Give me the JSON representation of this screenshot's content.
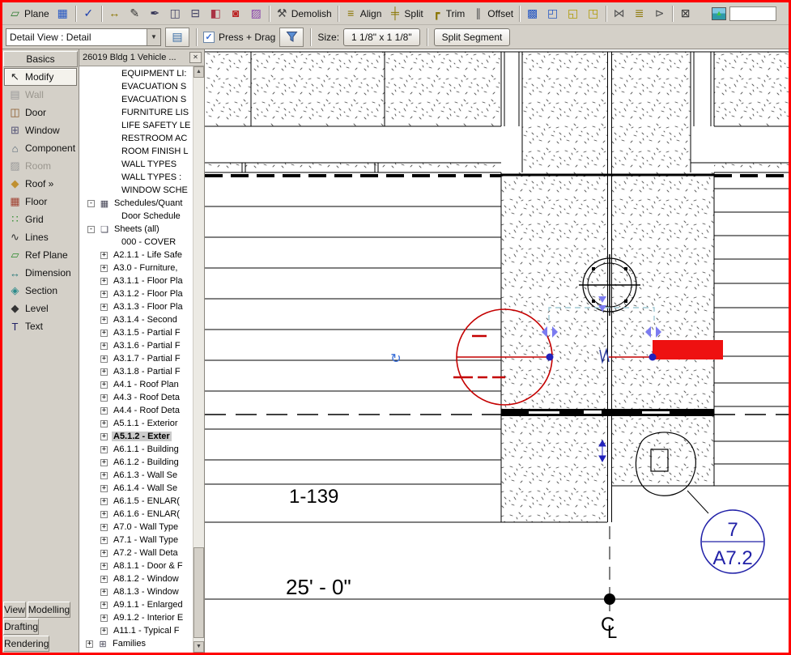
{
  "theme": {
    "window_border": "#ff0000",
    "toolbar_bg": "#d4d0c8",
    "selection_red": "#c40000",
    "fill_red": "#ee1111",
    "grip_blue": "#2222bb",
    "flip_blue": "#7b7bf0",
    "dash_cyan": "#9fc9d4",
    "callout_blue": "#2121a8",
    "rotate_blue": "#3a6fd8"
  },
  "toolbar_main": {
    "items": [
      {
        "name": "work-plane-button",
        "kind": "button",
        "glyph": "▱",
        "color": "#2f7d32",
        "label": "Plane"
      },
      {
        "name": "grid-snap-icon",
        "kind": "button",
        "glyph": "▦",
        "color": "#2356c4",
        "label": ""
      },
      {
        "kind": "sep"
      },
      {
        "name": "spelling-check-icon",
        "kind": "button",
        "glyph": "✓",
        "color": "#1d3fae",
        "label": ""
      },
      {
        "kind": "sep"
      },
      {
        "name": "tape-measure-icon",
        "kind": "button",
        "glyph": "↔",
        "color": "#8a7500",
        "label": ""
      },
      {
        "name": "match-type-icon",
        "kind": "button",
        "glyph": "✎",
        "color": "#333333",
        "label": ""
      },
      {
        "name": "linework-icon",
        "kind": "button",
        "glyph": "✒",
        "color": "#333355",
        "label": ""
      },
      {
        "name": "cut-geometry-icon",
        "kind": "button",
        "glyph": "◫",
        "color": "#444466",
        "label": ""
      },
      {
        "name": "join-geometry-icon",
        "kind": "button",
        "glyph": "⊟",
        "color": "#444466",
        "label": ""
      },
      {
        "name": "paint-icon",
        "kind": "button",
        "glyph": "◧",
        "color": "#aa3344",
        "label": ""
      },
      {
        "name": "opening-icon",
        "kind": "button",
        "glyph": "◙",
        "color": "#bb2222",
        "label": ""
      },
      {
        "name": "decal-icon",
        "kind": "button",
        "glyph": "▨",
        "color": "#8844aa",
        "label": ""
      },
      {
        "kind": "sep"
      },
      {
        "name": "demolish-button",
        "kind": "button",
        "glyph": "⚒",
        "color": "#444444",
        "label": "Demolish"
      },
      {
        "kind": "sep"
      },
      {
        "name": "align-button",
        "kind": "button",
        "glyph": "≡",
        "color": "#8a7500",
        "label": "Align"
      },
      {
        "name": "split-button",
        "kind": "button",
        "glyph": "╪",
        "color": "#8a7500",
        "label": "Split"
      },
      {
        "name": "trim-button",
        "kind": "button",
        "glyph": "┏",
        "color": "#8a7500",
        "label": "Trim"
      },
      {
        "name": "offset-button",
        "kind": "button",
        "glyph": "∥",
        "color": "#555555",
        "label": "Offset"
      },
      {
        "kind": "sep"
      },
      {
        "name": "group-icon",
        "kind": "button",
        "glyph": "▩",
        "color": "#2356c4",
        "label": ""
      },
      {
        "name": "ungroup-icon",
        "kind": "button",
        "glyph": "◰",
        "color": "#2356c4",
        "label": ""
      },
      {
        "name": "group-link-icon",
        "kind": "button",
        "glyph": "◱",
        "color": "#b09a00",
        "label": ""
      },
      {
        "name": "group-exclude-icon",
        "kind": "button",
        "glyph": "◳",
        "color": "#b09a00",
        "label": ""
      },
      {
        "kind": "sep"
      },
      {
        "name": "mirror-icon",
        "kind": "button",
        "glyph": "⋈",
        "color": "#555555",
        "label": ""
      },
      {
        "name": "array-icon",
        "kind": "button",
        "glyph": "≣",
        "color": "#8a7500",
        "label": ""
      },
      {
        "name": "pick-host-icon",
        "kind": "button",
        "glyph": "⊳",
        "color": "#555555",
        "label": ""
      },
      {
        "kind": "sep"
      },
      {
        "name": "wall-opening-icon",
        "kind": "button",
        "glyph": "⊠",
        "color": "#333333",
        "label": ""
      },
      {
        "kind": "gap"
      },
      {
        "name": "render-preview-icon",
        "kind": "image",
        "glyph": "▲",
        "color": "#3ec43e",
        "label": ""
      },
      {
        "name": "type-search-box",
        "kind": "inputbox",
        "glyph": "",
        "label": ""
      }
    ]
  },
  "toolbar_options": {
    "type_selector_value": "Detail View : Detail",
    "dropdown_arrow": "▼",
    "properties_glyph": "▤",
    "press_drag_checked": "✓",
    "press_drag_label": "Press + Drag",
    "size_label": "Size:",
    "size_value": "1 1/8\" x 1 1/8\"",
    "split_segment_label": "Split Segment"
  },
  "designbar": {
    "header": "Basics",
    "items": [
      {
        "name": "modify",
        "label": "Modify",
        "glyph": "↖",
        "color": "#222222",
        "state": "active"
      },
      {
        "name": "wall",
        "label": "Wall",
        "glyph": "▤",
        "color": "#999999",
        "state": "disabled"
      },
      {
        "name": "door",
        "label": "Door",
        "glyph": "◫",
        "color": "#8a5a2a",
        "state": "normal"
      },
      {
        "name": "window",
        "label": "Window",
        "glyph": "⊞",
        "color": "#555577",
        "state": "normal"
      },
      {
        "name": "component",
        "label": "Component",
        "glyph": "⌂",
        "color": "#556677",
        "state": "normal"
      },
      {
        "name": "room",
        "label": "Room",
        "glyph": "▨",
        "color": "#999999",
        "state": "disabled"
      },
      {
        "name": "roof",
        "label": "Roof »",
        "glyph": "◆",
        "color": "#c09030",
        "state": "normal"
      },
      {
        "name": "floor",
        "label": "Floor",
        "glyph": "▦",
        "color": "#a04030",
        "state": "normal"
      },
      {
        "name": "grid",
        "label": "Grid",
        "glyph": "∷",
        "color": "#2a8a2a",
        "state": "normal"
      },
      {
        "name": "lines",
        "label": "Lines",
        "glyph": "∿",
        "color": "#333333",
        "state": "normal"
      },
      {
        "name": "ref-plane",
        "label": "Ref Plane",
        "glyph": "▱",
        "color": "#2a8a2a",
        "state": "normal"
      },
      {
        "name": "dimension",
        "label": "Dimension",
        "glyph": "↔",
        "color": "#2a7a7a",
        "state": "normal"
      },
      {
        "name": "section",
        "label": "Section",
        "glyph": "◈",
        "color": "#2a8a8a",
        "state": "normal"
      },
      {
        "name": "level",
        "label": "Level",
        "glyph": "◆",
        "color": "#333333",
        "state": "normal"
      },
      {
        "name": "text",
        "label": "Text",
        "glyph": "T",
        "color": "#222266",
        "state": "normal"
      }
    ],
    "footer": [
      "View",
      "Modelling",
      "Drafting",
      "Rendering"
    ]
  },
  "browser": {
    "title": "26019 Bldg 1 Vehicle ...",
    "close_glyph": "✕",
    "scroll_up": "▲",
    "scroll_down": "▼",
    "expand_glyphs": {
      "plus": "+",
      "minus": "-"
    },
    "icon_glyphs": {
      "table": "▦",
      "sheet": "❏",
      "families": "⊞"
    },
    "items": [
      {
        "pad": 50,
        "label": "EQUIPMENT LI:"
      },
      {
        "pad": 50,
        "label": "EVACUATION S"
      },
      {
        "pad": 50,
        "label": "EVACUATION S"
      },
      {
        "pad": 50,
        "label": "FURNITURE LIS"
      },
      {
        "pad": 50,
        "label": "LIFE SAFETY LE"
      },
      {
        "pad": 50,
        "label": "RESTROOM AC"
      },
      {
        "pad": 50,
        "label": "ROOM FINISH L"
      },
      {
        "pad": 50,
        "label": "WALL TYPES"
      },
      {
        "pad": 50,
        "label": "WALL TYPES :"
      },
      {
        "pad": 50,
        "label": "WINDOW SCHE"
      },
      {
        "pad": 10,
        "box": "minus",
        "icon": "table",
        "label": "Schedules/Quant"
      },
      {
        "pad": 50,
        "label": "Door Schedule"
      },
      {
        "pad": 10,
        "box": "minus",
        "icon": "sheet",
        "label": "Sheets (all)"
      },
      {
        "pad": 50,
        "label": "000 - COVER"
      },
      {
        "pad": 26,
        "box": "plus",
        "label": "A2.1.1 - Life Safe"
      },
      {
        "pad": 26,
        "box": "plus",
        "label": "A3.0 - Furniture,"
      },
      {
        "pad": 26,
        "box": "plus",
        "label": "A3.1.1 - Floor Pla"
      },
      {
        "pad": 26,
        "box": "plus",
        "label": "A3.1.2 - Floor Pla"
      },
      {
        "pad": 26,
        "box": "plus",
        "label": "A3.1.3 - Floor Pla"
      },
      {
        "pad": 26,
        "box": "plus",
        "label": "A3.1.4 - Second"
      },
      {
        "pad": 26,
        "box": "plus",
        "label": "A3.1.5 - Partial F"
      },
      {
        "pad": 26,
        "box": "plus",
        "label": "A3.1.6 - Partial F"
      },
      {
        "pad": 26,
        "box": "plus",
        "label": "A3.1.7 - Partial F"
      },
      {
        "pad": 26,
        "box": "plus",
        "label": "A3.1.8 - Partial F"
      },
      {
        "pad": 26,
        "box": "plus",
        "label": "A4.1 - Roof Plan"
      },
      {
        "pad": 26,
        "box": "plus",
        "label": "A4.3 - Roof Deta"
      },
      {
        "pad": 26,
        "box": "plus",
        "label": "A4.4 - Roof Deta"
      },
      {
        "pad": 26,
        "box": "plus",
        "label": "A5.1.1 - Exterior"
      },
      {
        "pad": 26,
        "box": "plus",
        "label": "A5.1.2 - Exter",
        "bold": true
      },
      {
        "pad": 26,
        "box": "plus",
        "label": "A6.1.1 - Building"
      },
      {
        "pad": 26,
        "box": "plus",
        "label": "A6.1.2 - Building"
      },
      {
        "pad": 26,
        "box": "plus",
        "label": "A6.1.3 - Wall Se"
      },
      {
        "pad": 26,
        "box": "plus",
        "label": "A6.1.4 - Wall Se"
      },
      {
        "pad": 26,
        "box": "plus",
        "label": "A6.1.5 - ENLAR("
      },
      {
        "pad": 26,
        "box": "plus",
        "label": "A6.1.6 - ENLAR("
      },
      {
        "pad": 26,
        "box": "plus",
        "label": "A7.0 - Wall Type"
      },
      {
        "pad": 26,
        "box": "plus",
        "label": "A7.1 - Wall Type"
      },
      {
        "pad": 26,
        "box": "plus",
        "label": "A7.2 - Wall Deta"
      },
      {
        "pad": 26,
        "box": "plus",
        "label": "A8.1.1 - Door & F"
      },
      {
        "pad": 26,
        "box": "plus",
        "label": "A8.1.2 - Window"
      },
      {
        "pad": 26,
        "box": "plus",
        "label": "A8.1.3 - Window"
      },
      {
        "pad": 26,
        "box": "plus",
        "label": "A9.1.1 - Enlarged"
      },
      {
        "pad": 26,
        "box": "plus",
        "label": "A9.1.2 - Interior E"
      },
      {
        "pad": 26,
        "box": "plus",
        "label": "A11.1 - Typical F"
      },
      {
        "pad": 8,
        "box": "plus",
        "icon": "families",
        "label": "Families"
      }
    ]
  },
  "drawing": {
    "room_tag": "1-139",
    "dimension_text": "25' - 0\"",
    "callout_detail_number": "7",
    "callout_sheet_number": "A7.2",
    "centerline_c": "C",
    "centerline_l": "L",
    "rotate_glyph": "↻"
  }
}
